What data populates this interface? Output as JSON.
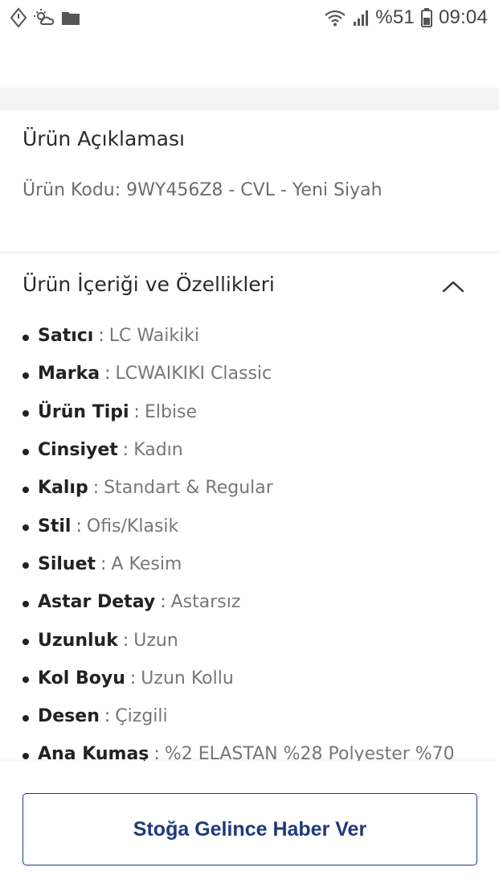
{
  "status_bar": {
    "battery_text": "%51",
    "time": "09:04",
    "icons_left": [
      "navigation-icon",
      "weather-icon",
      "folder-icon"
    ],
    "icons_right": [
      "wifi-icon",
      "signal-icon",
      "battery-icon"
    ]
  },
  "description": {
    "title": "Ürün Açıklaması",
    "product_code": "Ürün Kodu: 9WY456Z8 - CVL - Yeni Siyah"
  },
  "features": {
    "title": "Ürün İçeriği ve Özellikleri",
    "toggle_icon": "chevron-up-icon",
    "items": [
      {
        "name": "Satıcı",
        "value": "LC Waikiki"
      },
      {
        "name": "Marka",
        "value": "LCWAIKIKI Classic"
      },
      {
        "name": "Ürün Tipi",
        "value": "Elbise"
      },
      {
        "name": "Cinsiyet",
        "value": "Kadın"
      },
      {
        "name": "Kalıp",
        "value": "Standart & Regular"
      },
      {
        "name": "Stil",
        "value": "Ofis/Klasik"
      },
      {
        "name": "Siluet",
        "value": "A Kesim"
      },
      {
        "name": "Astar Detay",
        "value": "Astarsız"
      },
      {
        "name": "Uzunluk",
        "value": "Uzun"
      },
      {
        "name": "Kol Boyu",
        "value": "Uzun Kollu"
      },
      {
        "name": "Desen",
        "value": "Çizgili"
      },
      {
        "name": "Ana Kumaş",
        "value": "%2 ELASTAN %28 Polyester %70"
      }
    ]
  },
  "actions": {
    "notify_button_label": "Stoğa Gelince Haber Ver"
  },
  "colors": {
    "accent": "#1f3a7a",
    "text_dark": "#222222",
    "text_muted": "#777777",
    "band_gray": "#f3f3f3"
  }
}
